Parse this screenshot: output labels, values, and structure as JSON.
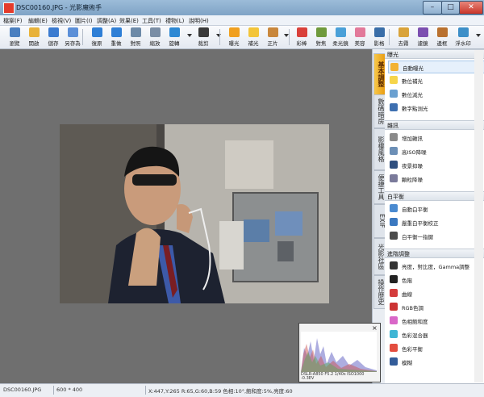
{
  "window": {
    "title": "DSC00160.JPG - 光影魔術手"
  },
  "menu": [
    "檔案(F)",
    "編輯(E)",
    "檢視(V)",
    "圖片(I)",
    "調整(A)",
    "效果(E)",
    "工具(T)",
    "禮物(L)",
    "說明(H)"
  ],
  "toolbar": [
    {
      "label": "瀏覽",
      "icon": "browse-icon",
      "color": "#4a7fc0"
    },
    {
      "label": "開啟",
      "icon": "open-folder-icon",
      "color": "#e8b23a"
    },
    {
      "label": "儲存",
      "icon": "save-icon",
      "color": "#3b7bd0"
    },
    {
      "label": "另存為",
      "icon": "save-as-icon",
      "color": "#5b8fd8"
    },
    {
      "label": "復原",
      "icon": "undo-icon",
      "color": "#2f7fd6"
    },
    {
      "label": "重做",
      "icon": "redo-icon",
      "color": "#2f7fd6"
    },
    {
      "label": "對照",
      "icon": "compare-icon",
      "color": "#6d8aa8"
    },
    {
      "label": "縮放",
      "icon": "zoom-icon",
      "color": "#7a8ea6"
    },
    {
      "label": "旋轉",
      "icon": "rotate-icon",
      "color": "#2c88d4"
    },
    {
      "label": "裁剪",
      "icon": "crop-icon",
      "color": "#3a3a3a"
    },
    {
      "label": "曝光",
      "icon": "exposure-icon",
      "color": "#f0a020"
    },
    {
      "label": "補光",
      "icon": "fill-light-icon",
      "color": "#f3c53a"
    },
    {
      "label": "正片",
      "icon": "film-icon",
      "color": "#c9873c"
    },
    {
      "label": "彩棒",
      "icon": "color-wand-icon",
      "color": "#d9403a"
    },
    {
      "label": "對焦",
      "icon": "focus-icon",
      "color": "#6f9a3c"
    },
    {
      "label": "柔光鏡",
      "icon": "soft-light-icon",
      "color": "#4aa0d8"
    },
    {
      "label": "美容",
      "icon": "beauty-icon",
      "color": "#e2799a"
    },
    {
      "label": "影格",
      "icon": "frame-icon",
      "color": "#3a6ea8"
    },
    {
      "label": "去霧",
      "icon": "dehaze-icon",
      "color": "#d9a33a"
    },
    {
      "label": "濾鏡",
      "icon": "filter-icon",
      "color": "#7c4fb0"
    },
    {
      "label": "邊框",
      "icon": "border-icon",
      "color": "#b9712f"
    },
    {
      "label": "浮水印",
      "icon": "watermark-icon",
      "color": "#3d8fc8"
    }
  ],
  "side_tabs": [
    {
      "label": "基本調整",
      "active": true
    },
    {
      "label": "數碼暗房",
      "active": false
    },
    {
      "label": "影樓風格",
      "active": false
    },
    {
      "label": "便捷工具",
      "active": false
    },
    {
      "label": "EXIF",
      "active": false
    },
    {
      "label": "光影社區",
      "active": false
    },
    {
      "label": "操作歷史",
      "active": false
    }
  ],
  "panel": {
    "sections": [
      {
        "title": "曝光",
        "items": [
          {
            "label": "自動曝光",
            "icon": "auto-exposure-icon",
            "color": "#f2b233",
            "selected": true
          },
          {
            "label": "數位補光",
            "icon": "digital-fill-icon",
            "color": "#f6d54a",
            "selected": false
          },
          {
            "label": "數位減光",
            "icon": "digital-reduce-icon",
            "color": "#6aa0d0",
            "selected": false
          },
          {
            "label": "數字點測光",
            "icon": "spot-meter-icon",
            "color": "#3d6fb0",
            "selected": false
          }
        ]
      },
      {
        "title": "雜訊",
        "items": [
          {
            "label": "增加雜訊",
            "icon": "add-noise-icon",
            "color": "#8a8a8a",
            "selected": false
          },
          {
            "label": "高ISO降噪",
            "icon": "iso-denoise-icon",
            "color": "#6c8fb6",
            "selected": false
          },
          {
            "label": "夜景抑噪",
            "icon": "night-denoise-icon",
            "color": "#2f4f7f",
            "selected": false
          },
          {
            "label": "顆粒降噪",
            "icon": "grain-denoise-icon",
            "color": "#7a7a9a",
            "selected": false
          }
        ]
      },
      {
        "title": "白平衡",
        "items": [
          {
            "label": "自動白平衡",
            "icon": "auto-wb-icon",
            "color": "#4a8ad0",
            "selected": false
          },
          {
            "label": "嚴重白平衡校正",
            "icon": "wb-correct-icon",
            "color": "#3a78c0",
            "selected": false
          },
          {
            "label": "白平衡一指鍵",
            "icon": "wb-picker-icon",
            "color": "#4b4b4b",
            "selected": false
          }
        ]
      },
      {
        "title": "進階調整",
        "items": [
          {
            "label": "亮度，對比度，Gamma調整",
            "icon": "brightness-icon",
            "color": "#333333",
            "selected": false
          },
          {
            "label": "色階",
            "icon": "levels-icon",
            "color": "#222222",
            "selected": false
          },
          {
            "label": "曲線",
            "icon": "curves-icon",
            "color": "#d43c3c",
            "selected": false
          },
          {
            "label": "RGB色調",
            "icon": "rgb-icon",
            "color": "#c33",
            "selected": false
          },
          {
            "label": "色相飽和度",
            "icon": "hue-sat-icon",
            "color": "#d967c8",
            "selected": false
          },
          {
            "label": "色彩混合器",
            "icon": "mixer-icon",
            "color": "#3fb5d4",
            "selected": false
          },
          {
            "label": "色彩平衡",
            "icon": "color-balance-icon",
            "color": "#e34d3f",
            "selected": false
          },
          {
            "label": "模糊",
            "icon": "blur-icon",
            "color": "#335c99",
            "selected": false
          }
        ]
      }
    ]
  },
  "histogram": {
    "close": "×",
    "meta": "DSLR-A850 F5.2 1/40s ISO1000 -0.3EV"
  },
  "status": {
    "filename": "DSC00160.JPG",
    "size": "600 * 400",
    "pixel_info": "X:447,Y:265 R:65,G:60,B:59 色相:10°,飽和度:5%,亮度:60"
  }
}
